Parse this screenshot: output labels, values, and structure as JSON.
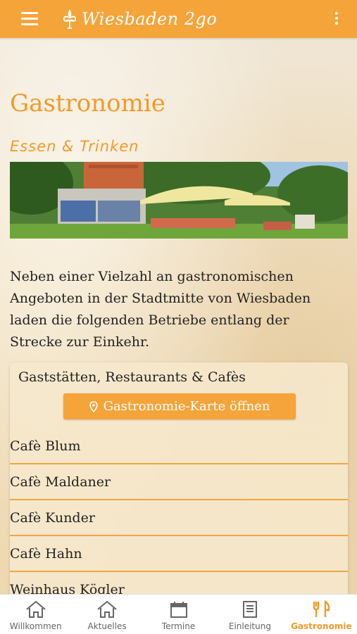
{
  "app": {
    "logo_text": "Wiesbaden 2go"
  },
  "page": {
    "title": "Gastronomie",
    "subtitle": "Essen & Trinken",
    "intro": "Neben einer Vielzahl an gastronomischen Angeboten in der Stadtmitte von Wiesbaden laden die folgenden Betriebe entlang der Strecke zur Einkehr."
  },
  "card": {
    "title": "Gaststätten, Restaurants & Cafès",
    "map_button_label": "Gastronomie-Karte öffnen",
    "items": [
      "Cafè Blum",
      "Cafè Maldaner",
      "Cafè Kunder",
      "Cafè Hahn",
      "Weinhaus Kögler"
    ]
  },
  "nav": {
    "tabs": [
      {
        "label": "Willkommen",
        "icon": "home-icon"
      },
      {
        "label": "Aktuelles",
        "icon": "home-icon"
      },
      {
        "label": "Termine",
        "icon": "calendar-icon"
      },
      {
        "label": "Einleitung",
        "icon": "book-icon"
      },
      {
        "label": "Gastronomie",
        "icon": "fork-knife-icon"
      }
    ],
    "active": "Gastronomie"
  },
  "colors": {
    "accent": "#f5a43a",
    "title": "#f39a2a"
  }
}
